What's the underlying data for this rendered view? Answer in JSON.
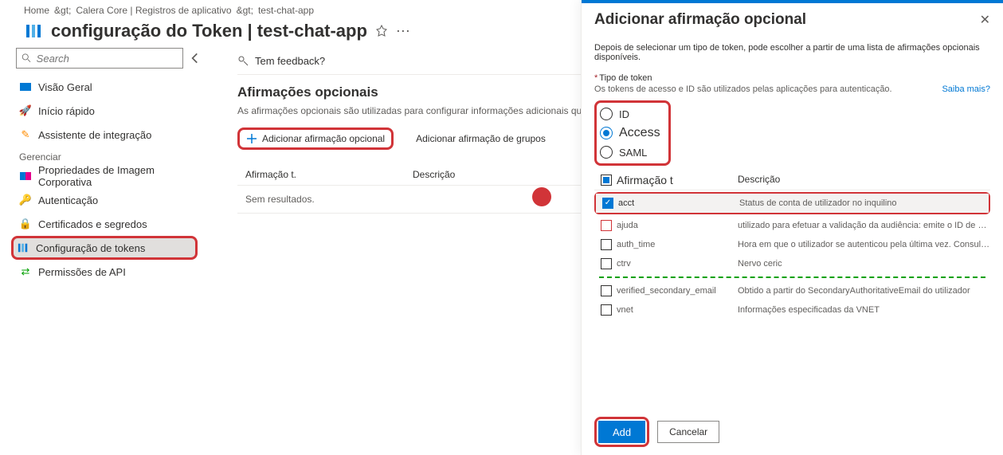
{
  "breadcrumb": {
    "home": "Home",
    "sep": "&gt;",
    "path1": "Calera Core | Registros de aplicativo",
    "path2": "test-chat-app"
  },
  "header": {
    "title": "configuração do Token | test-chat-app"
  },
  "search": {
    "placeholder": "Search"
  },
  "nav": {
    "overview": "Visão Geral",
    "quickstart": "Início rápido",
    "integration": "Assistente de integração",
    "manage_h": "Gerenciar",
    "branding": "Propriedades de Imagem Corporativa",
    "auth": "Autenticação",
    "certs": "Certificados e segredos",
    "tokens": "Configuração de tokens",
    "api": "Permissões de API"
  },
  "main": {
    "feedback": "Tem feedback?",
    "section_h": "Afirmações opcionais",
    "section_desc": "As afirmações opcionais são utilizadas para configurar informações adicionais que",
    "add_opt": "Adicionar afirmação opcional",
    "add_group": "Adicionar afirmação de grupos",
    "col1": "Afirmação t.",
    "col2": "Descrição",
    "empty": "Sem resultados."
  },
  "panel": {
    "title": "Adicionar afirmação opcional",
    "desc": "Depois de selecionar um tipo de token, pode escolher a partir de uma lista de afirmações opcionais disponíveis.",
    "field_label": "Tipo de token",
    "field_help": "Os tokens de acesso e ID são utilizados pelas aplicações para autenticação.",
    "learn_more": "Saiba mais?",
    "radios": {
      "id": "ID",
      "access": "Access",
      "saml": "SAML"
    },
    "th1": "Afirmação t",
    "th2": "Descrição",
    "rows": {
      "acct": {
        "name": "acct",
        "desc": "Status de conta de utilizador no inquilino"
      },
      "ajuda": {
        "name": "ajuda",
        "desc": "utilizado para efetuar a validação da audiência: emite o ID de cliente..."
      },
      "auth_time": {
        "name": "auth_time",
        "desc": "Hora em que o utilizador se autenticou pela última vez. Consulte Opened Con..."
      },
      "ctry": {
        "name": "ctrv",
        "desc": "Nervo ceric"
      },
      "verified_secondary_email": {
        "name": "verified_secondary_email",
        "desc": "Obtido a partir do SecondaryAuthoritativeEmail do utilizador"
      },
      "vnet": {
        "name": "vnet",
        "desc": "Informações especificadas da VNET"
      }
    },
    "add_btn": "Add",
    "cancel_btn": "Cancelar"
  }
}
